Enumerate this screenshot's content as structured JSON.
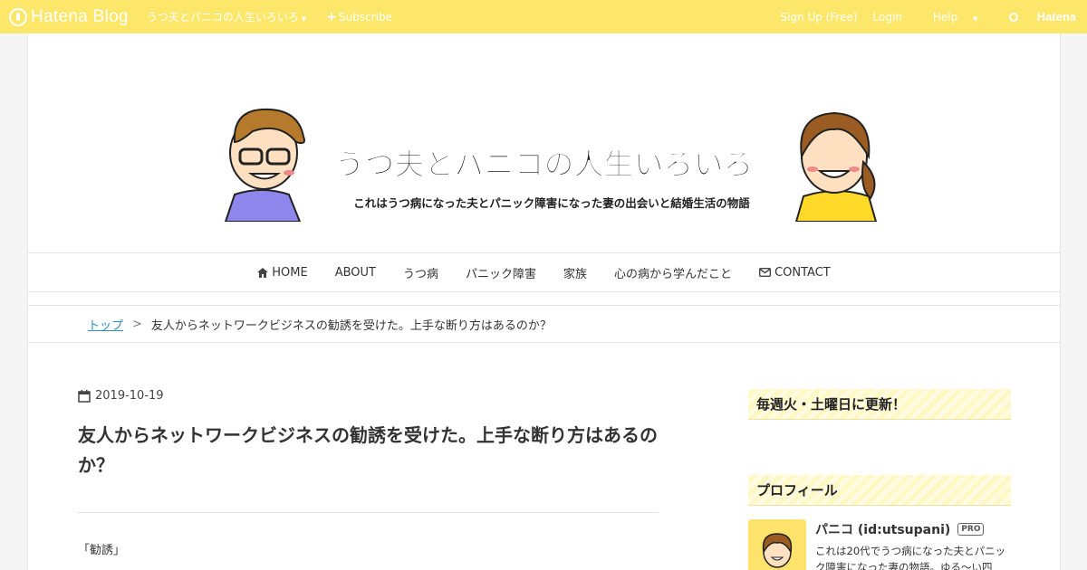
{
  "global_header": {
    "logo": "Hatena Blog",
    "blog_name": "うつ夫とパニコの人生いろいろ",
    "subscribe": "Subscribe",
    "signup": "Sign Up (Free)",
    "login": "Login",
    "help": "Help",
    "brand": "Hatena"
  },
  "banner": {
    "title": "うつ夫とパニコの人生いろいろ。",
    "subtitle": "これはうつ病になった夫とパニック障害になった妻の出会いと結婚生活の物語"
  },
  "nav": {
    "items": [
      "HOME",
      "ABOUT",
      "うつ病",
      "パニック障害",
      "家族",
      "心の病から学んだこと",
      "CONTACT"
    ]
  },
  "breadcrumb": {
    "top": "トップ",
    "separator": ">",
    "current": "友人からネットワークビジネスの勧誘を受けた。上手な断り方はあるのか？"
  },
  "article": {
    "date": "2019-10-19",
    "title": "友人からネットワークビジネスの勧誘を受けた。上手な断り方はあるのか？",
    "first_line": "「勧誘」"
  },
  "sidebar": {
    "update_title": "毎週火・土曜日に更新！",
    "profile_title": "プロフィール",
    "profile_name": "パニコ (id:utsupani)",
    "pro_badge": "PRO",
    "profile_desc": "これは20代でうつ病になった夫とパニック障害になった妻の物語。ゆる～い四"
  },
  "colors": {
    "header_bg": "#fde76b",
    "link": "#2a8cc1",
    "stripe": "#fff7c4"
  }
}
